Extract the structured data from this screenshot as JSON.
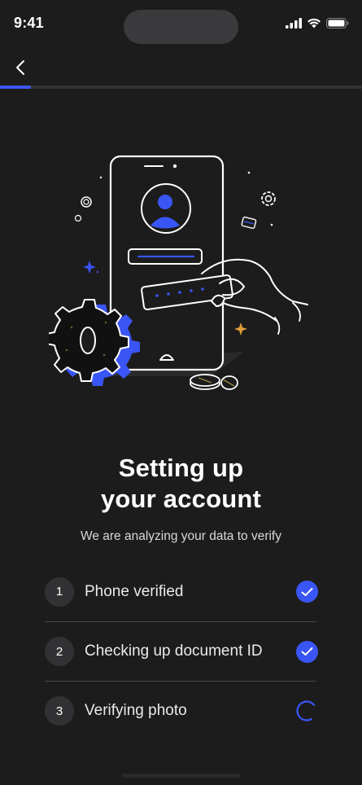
{
  "status_bar": {
    "time": "9:41"
  },
  "nav": {
    "back_icon": "chevron-left-icon",
    "progress_fraction": 0.085
  },
  "colors": {
    "accent": "#3a55f5",
    "background": "#1c1c1d",
    "step_circle": "#323234"
  },
  "header": {
    "title_line1": "Setting up",
    "title_line2": "your account",
    "subtitle": "We are analyzing your data to verify"
  },
  "steps": [
    {
      "number": "1",
      "label": "Phone verified",
      "status": "done",
      "status_icon": "check-icon"
    },
    {
      "number": "2",
      "label": "Checking up document ID",
      "status": "done",
      "status_icon": "check-icon"
    },
    {
      "number": "3",
      "label": "Verifying photo",
      "status": "in-progress",
      "status_icon": "spinner-icon"
    }
  ]
}
